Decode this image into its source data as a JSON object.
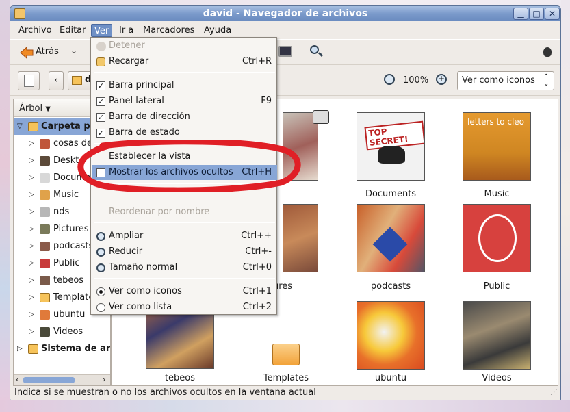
{
  "window": {
    "title": "david - Navegador de archivos"
  },
  "menubar": [
    "Archivo",
    "Editar",
    "Ver",
    "Ir a",
    "Marcadores",
    "Ayuda"
  ],
  "toolbar": {
    "back_label": "Atrás"
  },
  "location": {
    "current_folder": "d",
    "zoom": "100%",
    "view_mode": "Ver como iconos"
  },
  "sidebar": {
    "header": "Árbol",
    "items": [
      "Carpeta p",
      "cosas de",
      "Deskt",
      "Docume",
      "Music",
      "nds",
      "Pictures",
      "podcasts",
      "Public",
      "tebeos",
      "Template",
      "ubuntu",
      "Videos",
      "Sistema de ar"
    ]
  },
  "files": {
    "row1": [
      "Documents",
      "Music"
    ],
    "row2": [
      "ures",
      "podcasts",
      "Public"
    ],
    "row3": [
      "tebeos",
      "Templates",
      "ubuntu",
      "Videos"
    ]
  },
  "thumb_text": {
    "top_secret": "TOP SECRET!",
    "letters": "letters to cleo"
  },
  "status": "Indica si se muestran o no los archivos ocultos en la ventana actual",
  "view_menu": {
    "detener": "Detener",
    "recargar": "Recargar",
    "recargar_accel": "Ctrl+R",
    "barra_principal": "Barra principal",
    "panel_lateral": "Panel lateral",
    "panel_lateral_accel": "F9",
    "barra_direccion": "Barra de dirección",
    "barra_estado": "Barra de estado",
    "establecer_vista": "Establecer la vista",
    "mostrar_ocultos": "Mostrar los archivos ocultos",
    "mostrar_ocultos_accel": "Ctrl+H",
    "reordenar": "Reordenar por nombre",
    "ampliar": "Ampliar",
    "ampliar_accel": "Ctrl++",
    "reducir": "Reducir",
    "reducir_accel": "Ctrl+-",
    "tamano_normal": "Tamaño normal",
    "tamano_normal_accel": "Ctrl+0",
    "ver_iconos": "Ver como iconos",
    "ver_iconos_accel": "Ctrl+1",
    "ver_lista": "Ver como lista",
    "ver_lista_accel": "Ctrl+2"
  },
  "colors": {
    "highlight": "#88a6d6",
    "annotation": "#e01f26",
    "title_bar": "#7b9acb"
  }
}
